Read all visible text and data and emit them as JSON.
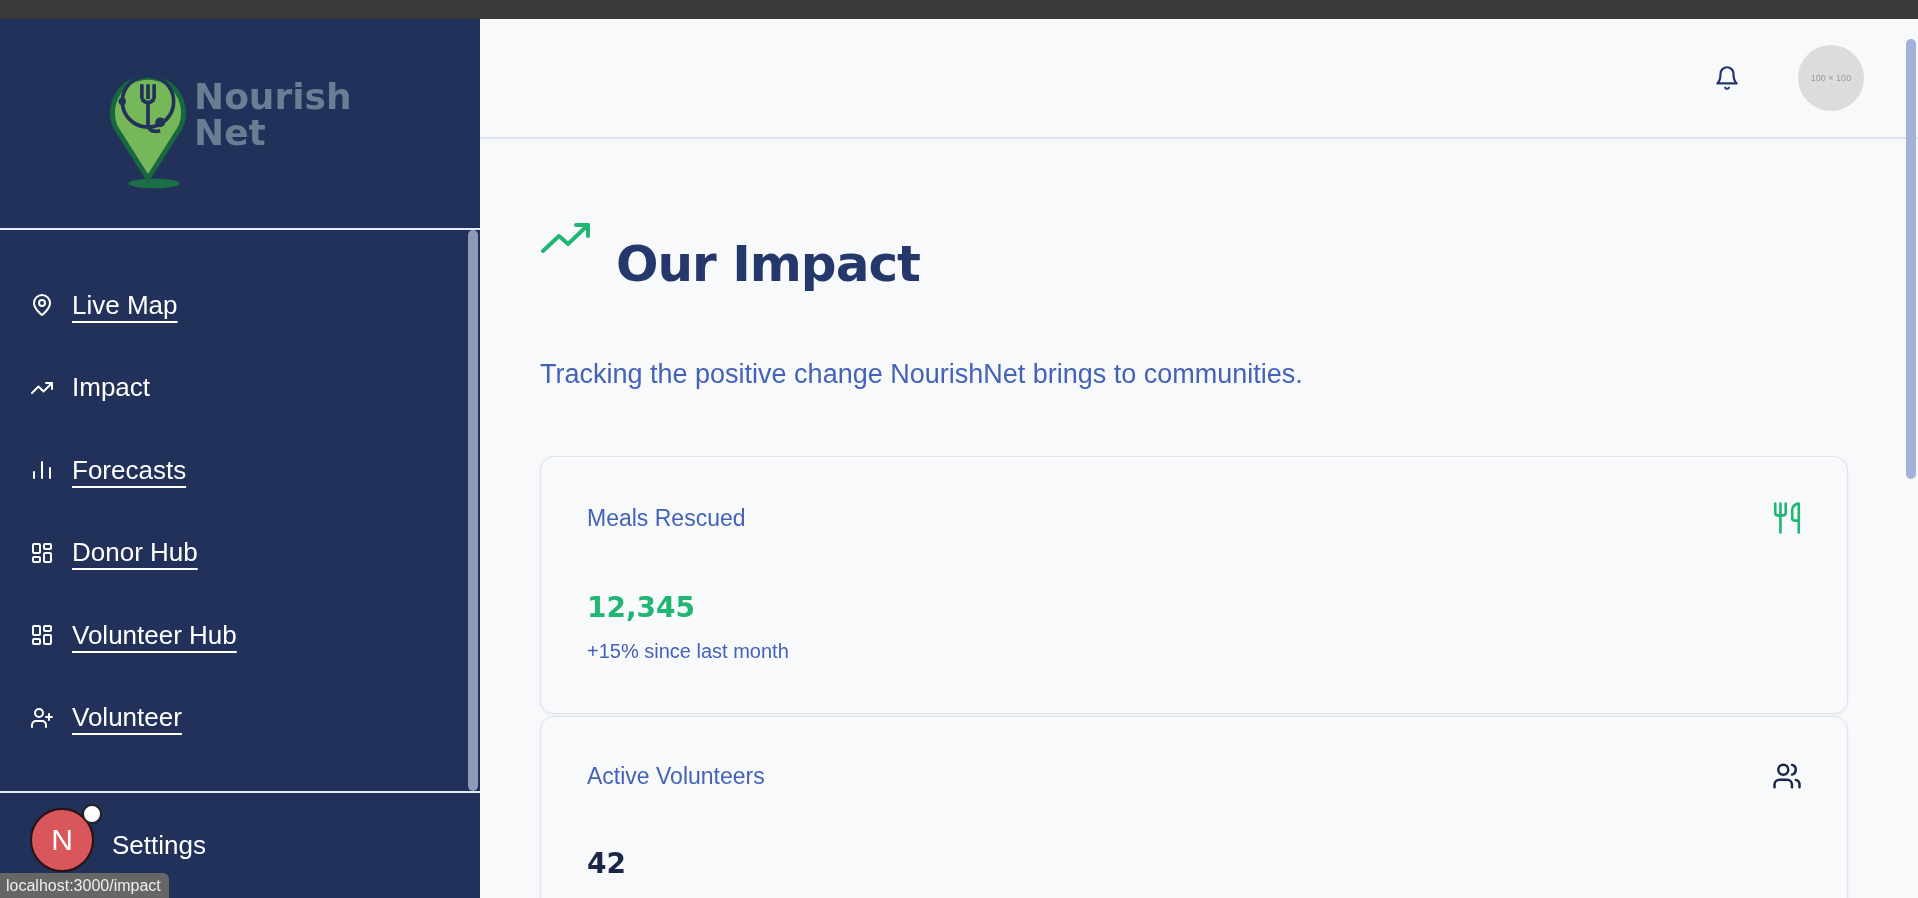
{
  "sidebar": {
    "logo": {
      "lines": [
        "Nourish",
        "Net"
      ]
    },
    "items": [
      {
        "label": "Live Map",
        "selected": false
      },
      {
        "label": "Impact",
        "selected": true
      },
      {
        "label": "Forecasts",
        "selected": false
      },
      {
        "label": "Donor Hub",
        "selected": false
      },
      {
        "label": "Volunteer Hub",
        "selected": false
      },
      {
        "label": "Volunteer",
        "selected": false
      }
    ],
    "footer": {
      "label": "Settings"
    },
    "dev_badge": {
      "letter": "N"
    }
  },
  "header": {
    "avatar": {
      "placeholder": "100 × 100"
    }
  },
  "page": {
    "title": "Our Impact",
    "subtitle": "Tracking the positive change NourishNet brings to communities."
  },
  "cards": [
    {
      "label": "Meals Rescued",
      "value": "12,345",
      "color": "#22b573",
      "note": "+15% since last month"
    },
    {
      "label": "Active Volunteers",
      "value": "42",
      "color": "#1a2747"
    }
  ],
  "status_bar": {
    "url": "localhost:3000/impact"
  }
}
